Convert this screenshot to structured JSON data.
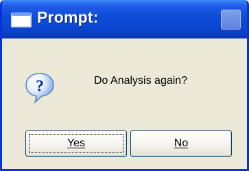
{
  "window": {
    "title": "Prompt:",
    "accent_color": "#0a3fc2",
    "background_color": "#ece9d8"
  },
  "icons": {
    "title_icon": "window-icon",
    "message_icon": "question-icon",
    "close_icon": "close-icon"
  },
  "message": {
    "text": "Do Analysis again?"
  },
  "buttons": {
    "yes_label": "Yes",
    "no_label": "No"
  }
}
